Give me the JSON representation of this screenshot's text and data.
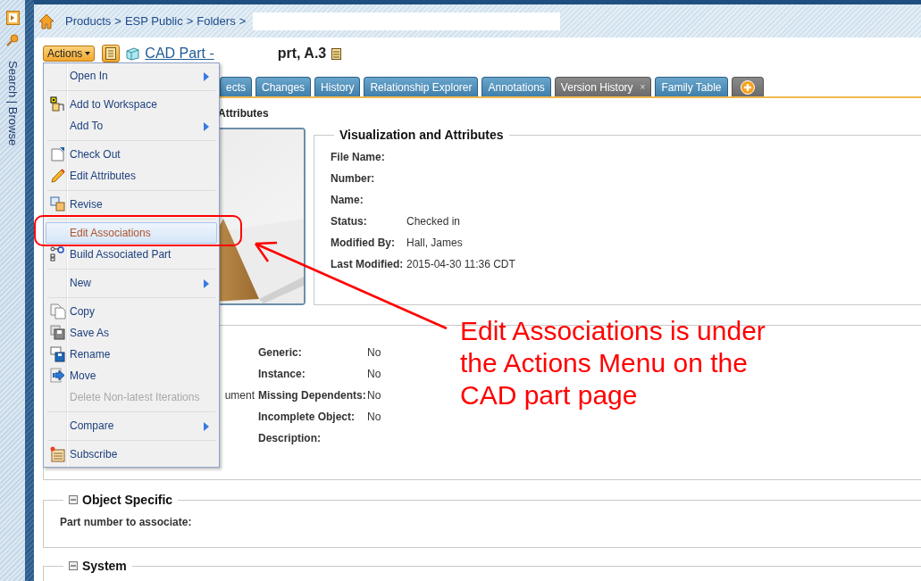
{
  "sidebar": {
    "label": "Search | Browse"
  },
  "breadcrumb": {
    "separator": ">",
    "items": [
      {
        "label": "Products"
      },
      {
        "label": "ESP Public"
      },
      {
        "label": "Folders"
      }
    ]
  },
  "header": {
    "actions_label": "Actions",
    "title_link": "CAD Part -",
    "title_suffix": "prt, A.3"
  },
  "tabs": [
    {
      "label": "ects",
      "kind": "standard"
    },
    {
      "label": "Changes",
      "kind": "standard"
    },
    {
      "label": "History",
      "kind": "standard"
    },
    {
      "label": "Relationship Explorer",
      "kind": "standard"
    },
    {
      "label": "Annotations",
      "kind": "standard"
    },
    {
      "label": "Version History",
      "kind": "custom",
      "close": "×"
    },
    {
      "label": "Family Table",
      "kind": "standard"
    },
    {
      "kind": "add"
    }
  ],
  "section_heading": "Attributes",
  "visualization": {
    "title": "Visualization and Attributes",
    "rows": [
      {
        "label": "File Name:"
      },
      {
        "label": "Number:"
      },
      {
        "label": "Name:"
      },
      {
        "label": "Status:",
        "value": "Checked in"
      },
      {
        "label": "Modified By:",
        "value": "Hall, James"
      },
      {
        "label": "Last Modified:",
        "value": "2015-04-30 11:36 CDT"
      }
    ]
  },
  "details": {
    "fragment": "ument",
    "rows": [
      {
        "label": "Generic:",
        "value": "No"
      },
      {
        "label": "Instance:",
        "value": "No"
      },
      {
        "label": "Missing Dependents:",
        "value": "No"
      },
      {
        "label": "Incomplete Object:",
        "value": "No"
      },
      {
        "label": "Description:"
      }
    ]
  },
  "object_specific": {
    "title": "Object Specific",
    "expanded": true,
    "rows": [
      {
        "label": "Part number to associate:"
      }
    ]
  },
  "system": {
    "title": "System",
    "expanded": true
  },
  "actions_menu": {
    "items": [
      {
        "label": "Open In",
        "submenu": true,
        "disabled": false,
        "selected": false
      },
      {
        "kind": "separator"
      },
      {
        "label": "Add to Workspace",
        "submenu": false,
        "disabled": false,
        "selected": false
      },
      {
        "label": "Add To",
        "submenu": true,
        "disabled": false,
        "selected": false
      },
      {
        "kind": "separator"
      },
      {
        "label": "Check Out",
        "submenu": false,
        "disabled": false,
        "selected": false
      },
      {
        "label": "Edit Attributes",
        "submenu": false,
        "disabled": false,
        "selected": false
      },
      {
        "kind": "separator"
      },
      {
        "label": "Revise",
        "submenu": false,
        "disabled": false,
        "selected": false
      },
      {
        "kind": "separator"
      },
      {
        "label": "Edit Associations",
        "submenu": false,
        "disabled": false,
        "selected": true
      },
      {
        "label": "Build Associated Part",
        "submenu": false,
        "disabled": false,
        "selected": false
      },
      {
        "kind": "separator"
      },
      {
        "label": "New",
        "submenu": true,
        "disabled": false,
        "selected": false
      },
      {
        "kind": "separator"
      },
      {
        "label": "Copy",
        "submenu": false,
        "disabled": false,
        "selected": false
      },
      {
        "label": "Save As",
        "submenu": false,
        "disabled": false,
        "selected": false
      },
      {
        "label": "Rename",
        "submenu": false,
        "disabled": false,
        "selected": false
      },
      {
        "label": "Move",
        "submenu": false,
        "disabled": false,
        "selected": false
      },
      {
        "label": "Delete Non-latest Iterations",
        "submenu": false,
        "disabled": true,
        "selected": false
      },
      {
        "kind": "separator"
      },
      {
        "label": "Compare",
        "submenu": true,
        "disabled": false,
        "selected": false
      },
      {
        "kind": "separator"
      },
      {
        "label": "Subscribe",
        "submenu": false,
        "disabled": false,
        "selected": false
      }
    ]
  },
  "annotation": {
    "lines": [
      "Edit Associations is under",
      "the Actions Menu on the",
      "CAD part page"
    ]
  }
}
